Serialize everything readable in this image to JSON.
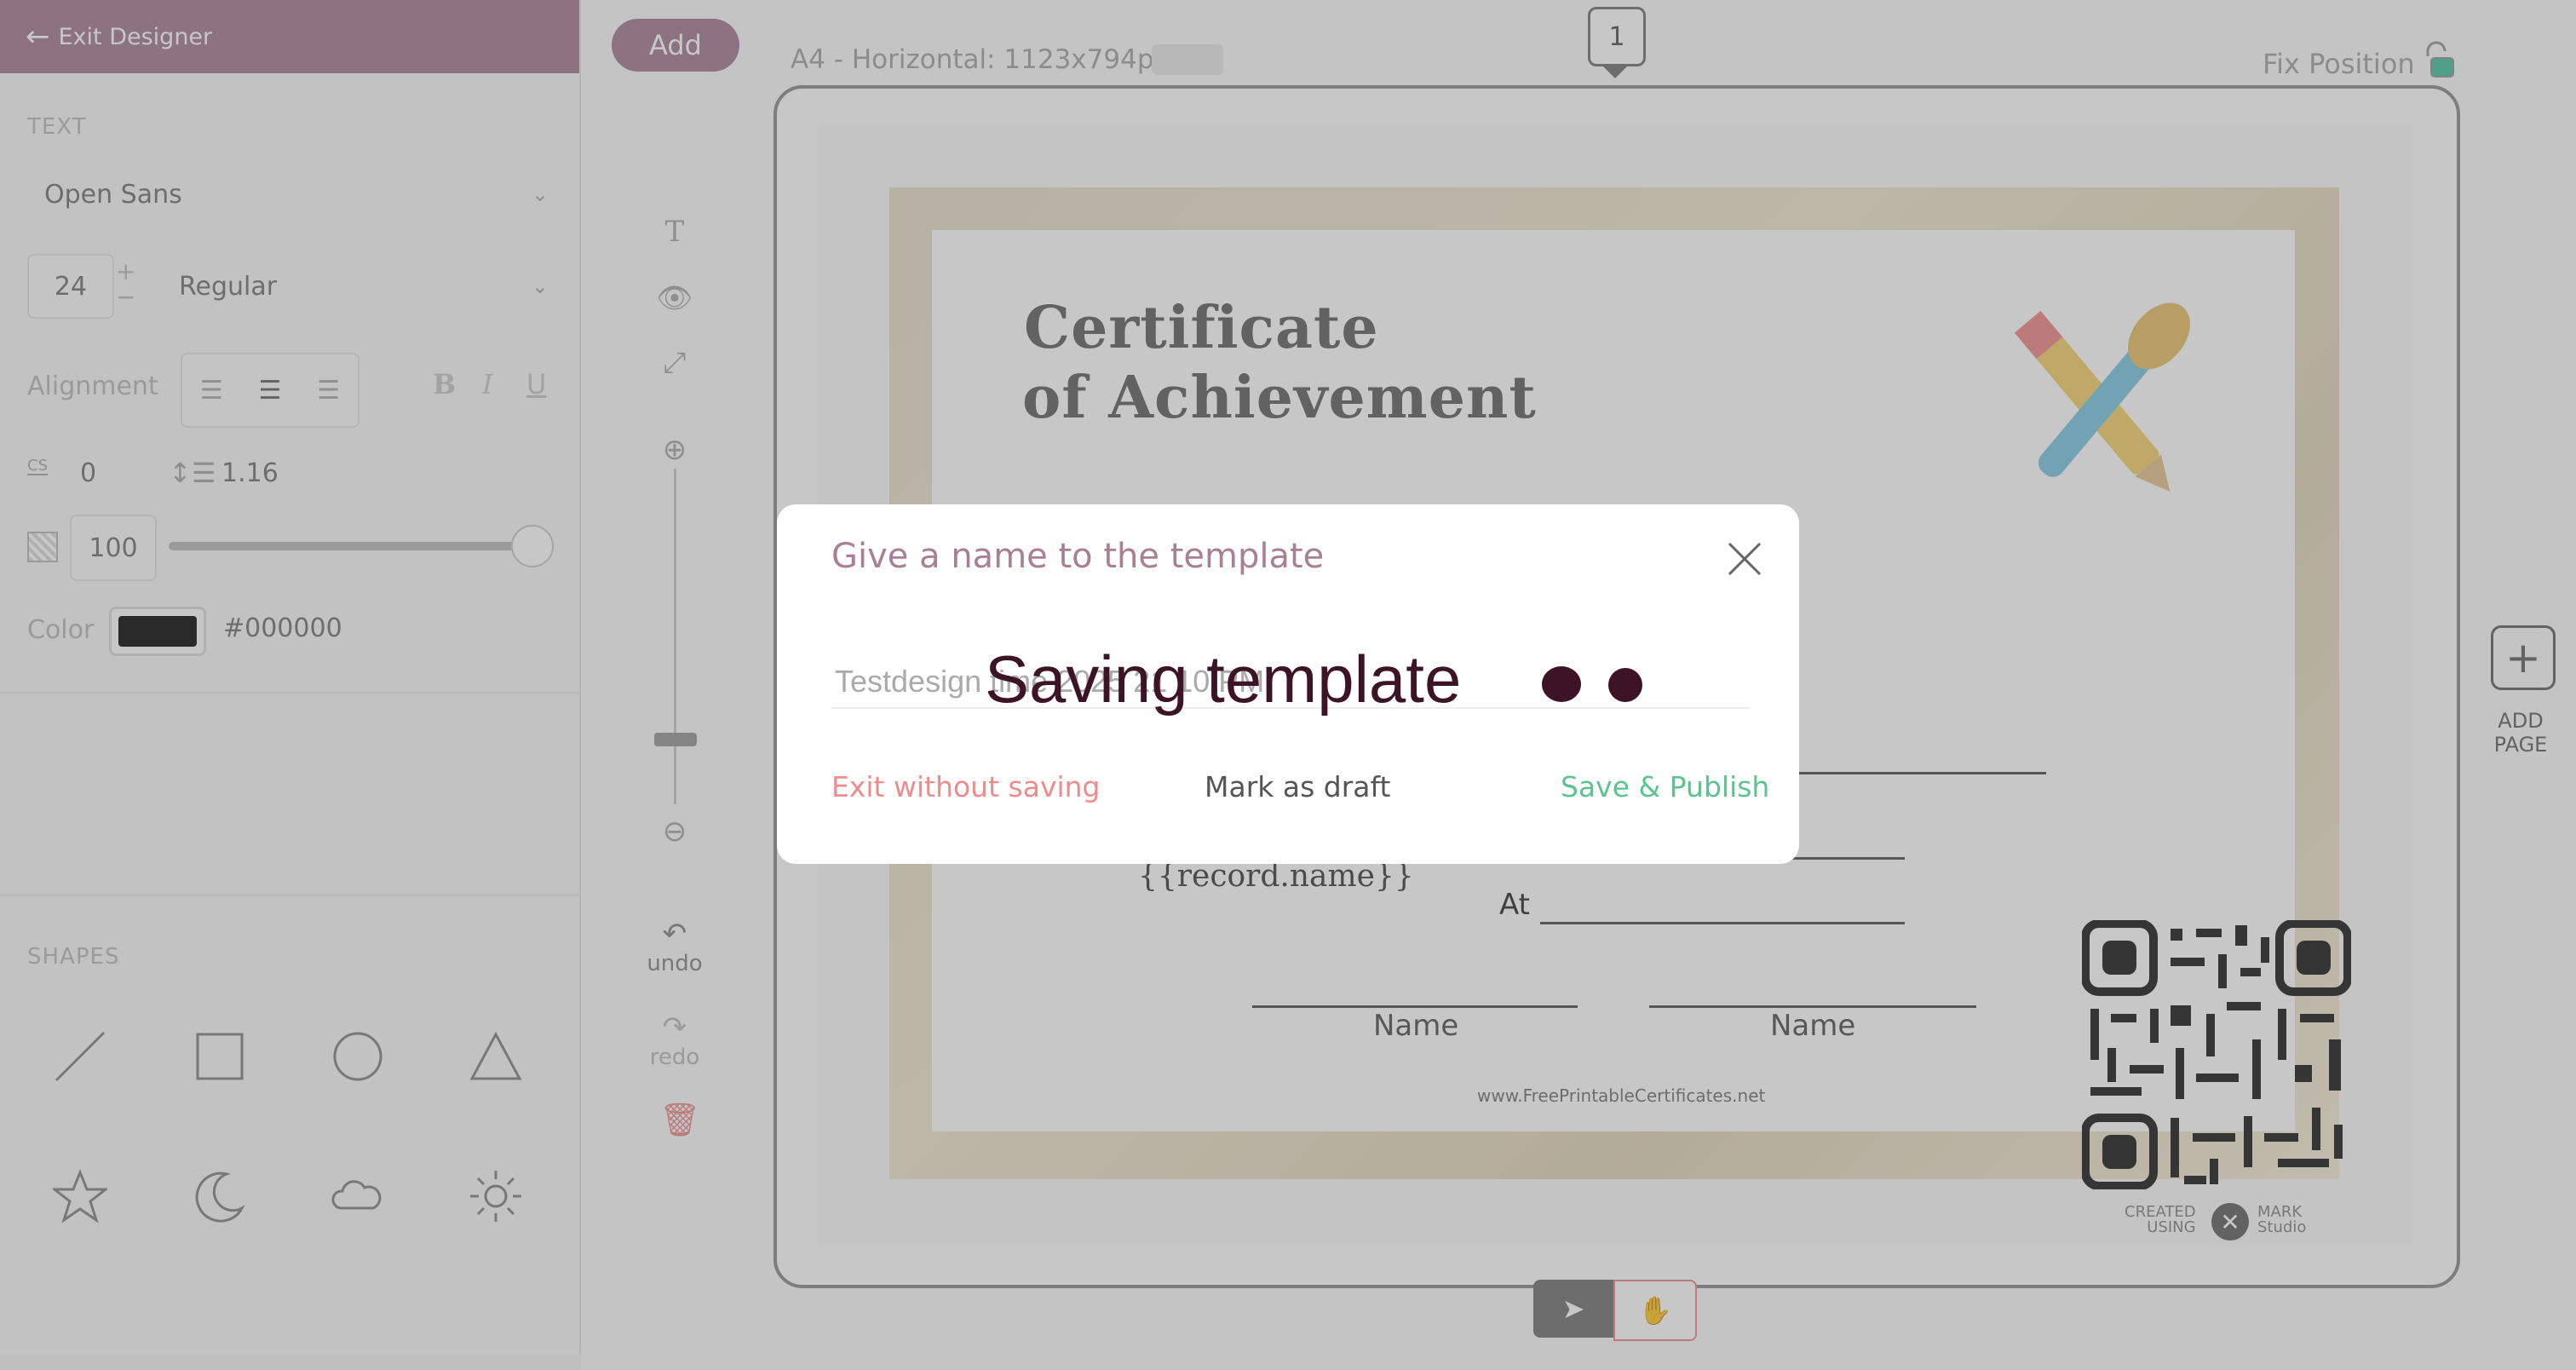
{
  "sidebar": {
    "exit_label": "Exit Designer",
    "text_section": "TEXT",
    "font_family": "Open Sans",
    "font_size": "24",
    "font_weight": "Regular",
    "alignment_label": "Alignment",
    "letter_spacing_icon": "CS",
    "letter_spacing": "0",
    "line_height": "1.16",
    "opacity": "100",
    "opacity_level": 1.0,
    "color_label": "Color",
    "color_value": "#000000",
    "shapes_section": "SHAPES",
    "shapes": [
      "line-icon",
      "square-icon",
      "circle-icon",
      "triangle-icon",
      "star-icon",
      "moon-icon",
      "cloud-icon",
      "sun-icon"
    ]
  },
  "toolbar": {
    "add_label": "Add",
    "page_meta": "A4 - Horizontal: 1123x794px",
    "page_number": "1",
    "fix_position": "Fix Position",
    "undo": "undo",
    "redo": "redo"
  },
  "certificate": {
    "title_line1": "Certificate",
    "title_line2": "of Achievement",
    "record_name": "{{record.name}}",
    "at_label": "At",
    "name_label_1": "Name",
    "name_label_2": "Name",
    "url": "www.FreePrintableCertificates.net",
    "created_using_1": "CREATED",
    "created_using_2": "USING",
    "brand_1": "MARK",
    "brand_2": "Studio"
  },
  "add_page": {
    "line1": "ADD",
    "line2": "PAGE"
  },
  "modal": {
    "title": "Give a name to the template",
    "input_value": "Testdesign time 2025 21 10 PM",
    "saving_text": "Saving template",
    "exit_label": "Exit without saving",
    "draft_label": "Mark as draft",
    "publish_label": "Save & Publish"
  },
  "colors": {
    "accent": "#a87f95",
    "saving": "#3d1426",
    "exit_action": "#ee8b8b",
    "publish_action": "#5cc48f"
  }
}
